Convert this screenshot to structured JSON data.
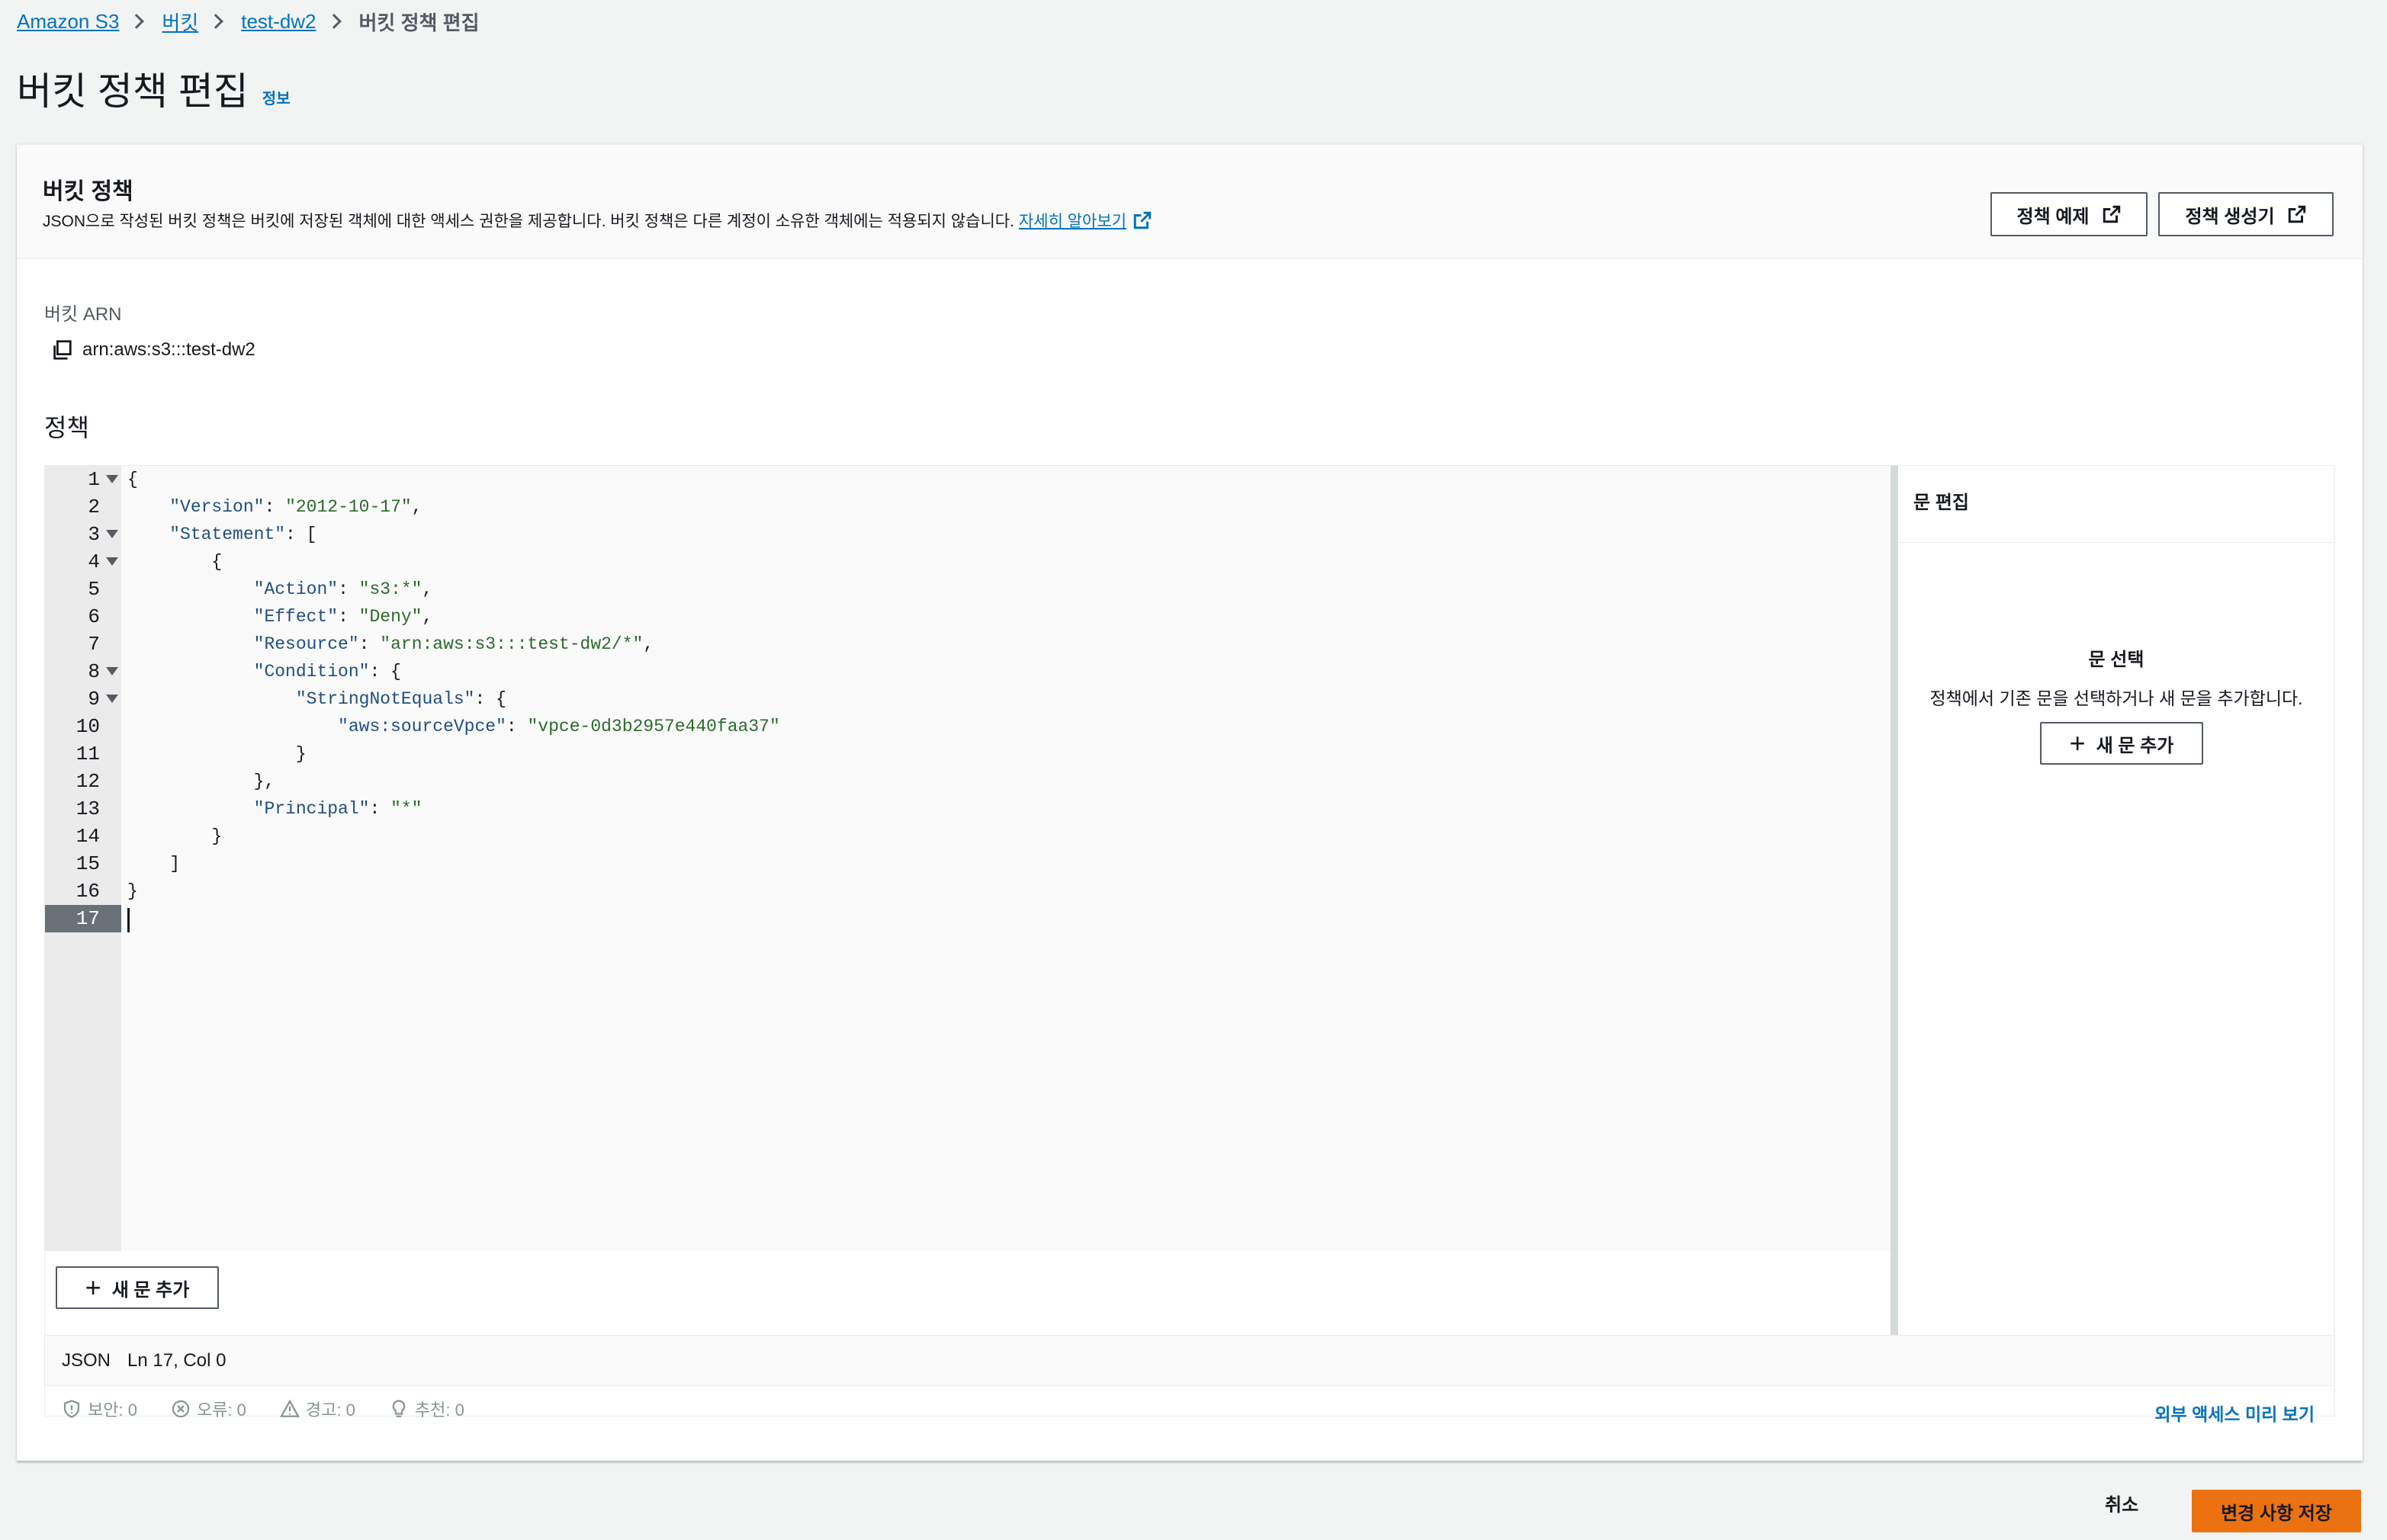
{
  "breadcrumb": {
    "items": [
      "Amazon S3",
      "버킷",
      "test-dw2"
    ],
    "current": "버킷 정책 편집"
  },
  "page": {
    "title": "버킷 정책 편집",
    "info": "정보"
  },
  "policy_card": {
    "title": "버킷 정책",
    "description": "JSON으로 작성된 버킷 정책은 버킷에 저장된 객체에 대한 액세스 권한을 제공합니다. 버킷 정책은 다른 계정이 소유한 객체에는 적용되지 않습니다.",
    "learn_more": "자세히 알아보기",
    "examples_button": "정책 예제",
    "generator_button": "정책 생성기"
  },
  "arn": {
    "label": "버킷 ARN",
    "value": "arn:aws:s3:::test-dw2"
  },
  "editor": {
    "label": "정책",
    "line_numbers": [
      "1",
      "2",
      "3",
      "4",
      "5",
      "6",
      "7",
      "8",
      "9",
      "10",
      "11",
      "12",
      "13",
      "14",
      "15",
      "16",
      "17"
    ],
    "active_line": "17",
    "foldable_lines": [
      "1",
      "3",
      "4",
      "8",
      "9"
    ],
    "code": {
      "version_value": "\"2012-10-17\"",
      "action_value": "\"s3:*\"",
      "effect_value": "\"Deny\"",
      "resource_value": "\"arn:aws:s3:::test-dw2/*\"",
      "source_vpce_value": "\"vpce-0d3b2957e440faa37\"",
      "principal_value": "\"*\""
    },
    "add_statement_button": "새 문 추가",
    "status_mode": "JSON",
    "status_position": "Ln 17, Col 0",
    "lint": {
      "security": "보안: 0",
      "errors": "오류: 0",
      "warnings": "경고: 0",
      "suggestions": "추천: 0"
    },
    "external_access_preview": "외부 액세스 미리 보기"
  },
  "side_panel": {
    "title": "문 편집",
    "heading": "문 선택",
    "message": "정책에서 기존 문을 선택하거나 새 문을 추가합니다.",
    "add_button": "새 문 추가"
  },
  "footer": {
    "cancel": "취소",
    "save": "변경 사항 저장"
  },
  "colors": {
    "link": "#0073bb",
    "primary_button": "#ec7211",
    "string_value": "#2b6a2b",
    "json_key": "#1f4f7f"
  }
}
